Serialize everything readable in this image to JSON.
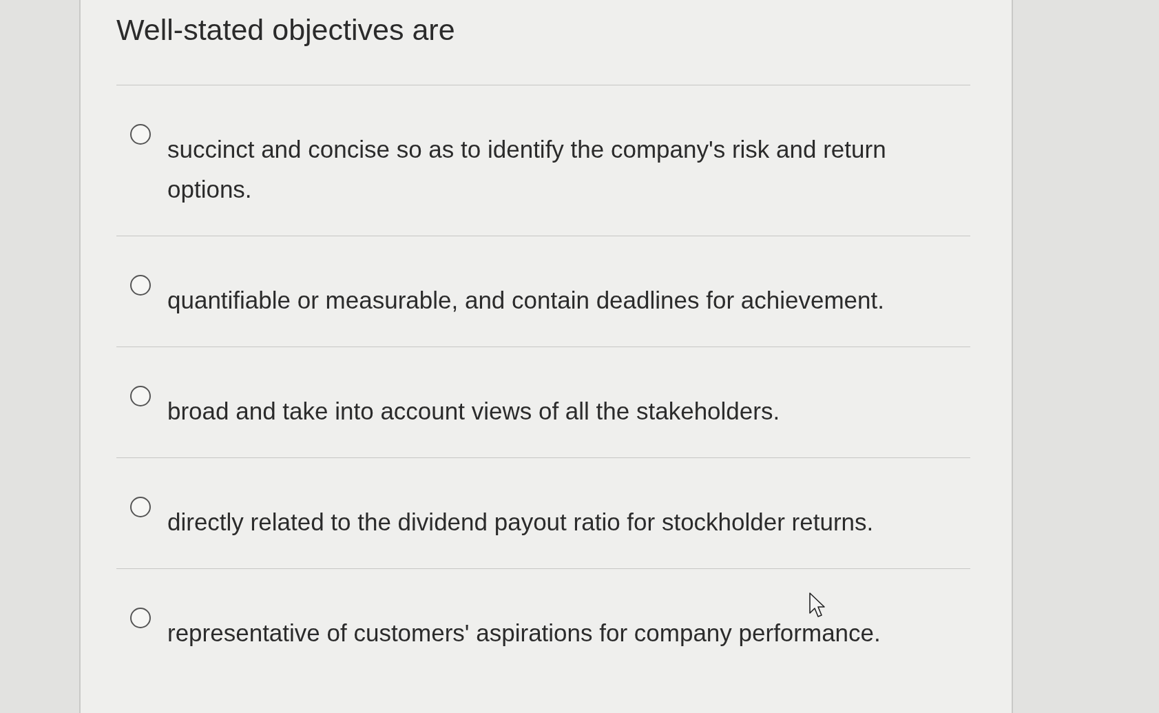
{
  "question": {
    "text": "Well-stated objectives are"
  },
  "options": [
    {
      "label": "succinct and concise so as to identify the company's risk and return options.",
      "selected": false
    },
    {
      "label": "quantifiable or measurable, and contain deadlines for achievement.",
      "selected": false
    },
    {
      "label": "broad and take into account views of all the stakeholders.",
      "selected": false
    },
    {
      "label": "directly related to the dividend payout ratio for stockholder returns.",
      "selected": false
    },
    {
      "label": "representative of customers' aspirations for company performance.",
      "selected": false
    }
  ]
}
